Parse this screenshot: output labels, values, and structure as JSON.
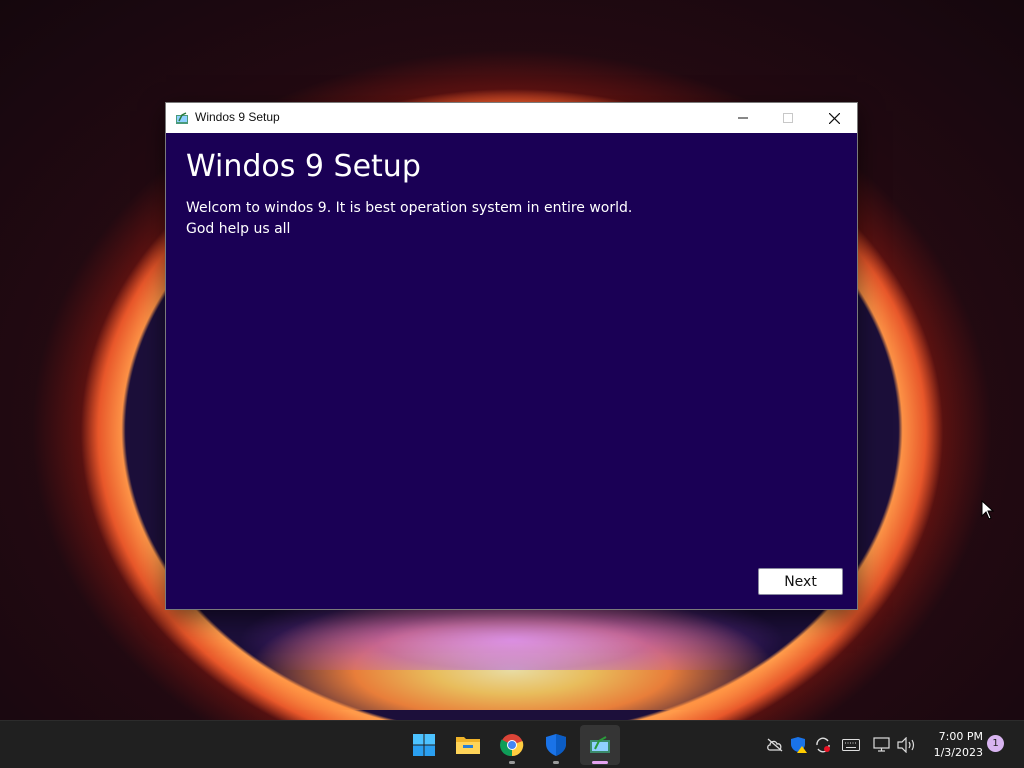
{
  "window": {
    "title": "Windos 9 Setup",
    "heading": "Windos 9 Setup",
    "line1": "Welcom to windos 9. It is best operation system in entire world.",
    "line2": "God help us all",
    "next_label": "Next",
    "background_color": "#1a0055",
    "controls": [
      "minimize-icon",
      "maximize-icon",
      "close-icon"
    ]
  },
  "taskbar": {
    "apps": [
      {
        "name": "start",
        "icon": "windows-logo-icon"
      },
      {
        "name": "file-explorer",
        "icon": "folder-icon"
      },
      {
        "name": "chrome",
        "icon": "chrome-icon"
      },
      {
        "name": "windows-security",
        "icon": "shield-icon"
      },
      {
        "name": "setup",
        "icon": "setup-icon"
      }
    ],
    "tray": [
      "cloud-offline-icon",
      "security-warning-icon",
      "sync-icon",
      "keyboard-icon",
      "network-icon",
      "volume-icon"
    ],
    "time": "7:00 PM",
    "date": "1/3/2023",
    "notification_count": "1",
    "background_color": "#202020"
  }
}
